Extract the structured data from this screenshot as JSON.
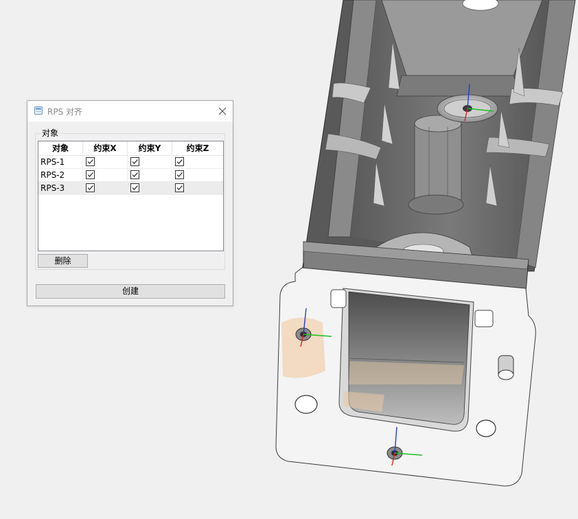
{
  "dialog": {
    "title": "RPS 对齐",
    "group_label": "对象",
    "columns": [
      "对象",
      "约束X",
      "约束Y",
      "约束Z"
    ],
    "rows": [
      {
        "name": "RPS-1",
        "x": true,
        "y": true,
        "z": true
      },
      {
        "name": "RPS-2",
        "x": true,
        "y": true,
        "z": true
      },
      {
        "name": "RPS-3",
        "x": true,
        "y": true,
        "z": true
      }
    ],
    "delete_label": "删除",
    "create_label": "创建"
  },
  "icons": {
    "app": "rps-app-icon",
    "close": "close-icon",
    "check": "check-icon"
  },
  "colors": {
    "axis_x": "#1fbf1f",
    "axis_y": "#e01e1e",
    "axis_z": "#1e3ce0",
    "part_face": "#6e6e6e",
    "flange": "#f5f5f5",
    "scan_patch": "#f1d6b8"
  }
}
